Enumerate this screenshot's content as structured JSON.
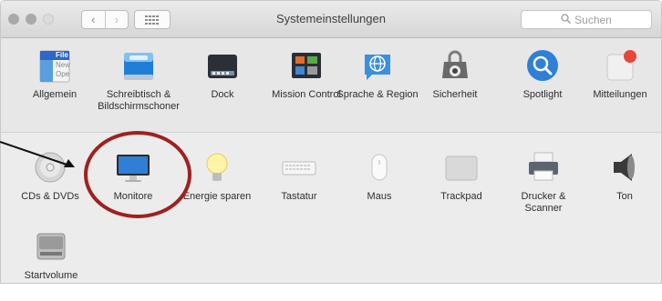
{
  "window": {
    "title": "Systemeinstellungen",
    "search_placeholder": "Suchen",
    "nav_back": "‹",
    "nav_forward": "›"
  },
  "colors": {
    "annotation_circle": "#a02020",
    "highlight_icon": "#2f7fd6"
  },
  "row1": [
    {
      "label": "Allgemein",
      "icon": "general-icon"
    },
    {
      "label": "Schreibtisch & Bildschirmschoner",
      "icon": "desktop-screensaver-icon"
    },
    {
      "label": "Dock",
      "icon": "dock-icon"
    },
    {
      "label": "Mission Control",
      "icon": "mission-control-icon"
    },
    {
      "label": "Sprache & Region",
      "icon": "language-region-icon"
    },
    {
      "label": "Sicherheit",
      "icon": "security-icon"
    },
    {
      "label": "Spotlight",
      "icon": "spotlight-icon"
    },
    {
      "label": "Mitteilungen",
      "icon": "notifications-icon"
    }
  ],
  "row2": [
    {
      "label": "CDs & DVDs",
      "icon": "cd-dvd-icon"
    },
    {
      "label": "Monitore",
      "icon": "monitor-icon"
    },
    {
      "label": "Energie sparen",
      "icon": "energy-saver-icon"
    },
    {
      "label": "Tastatur",
      "icon": "keyboard-icon"
    },
    {
      "label": "Maus",
      "icon": "mouse-icon"
    },
    {
      "label": "Trackpad",
      "icon": "trackpad-icon"
    },
    {
      "label": "Drucker & Scanner",
      "icon": "printer-scanner-icon"
    },
    {
      "label": "Ton",
      "icon": "sound-icon"
    }
  ],
  "row3": [
    {
      "label": "Startvolume",
      "icon": "startup-disk-icon"
    }
  ],
  "general_icon_text": [
    "File",
    "New",
    "Ope"
  ]
}
